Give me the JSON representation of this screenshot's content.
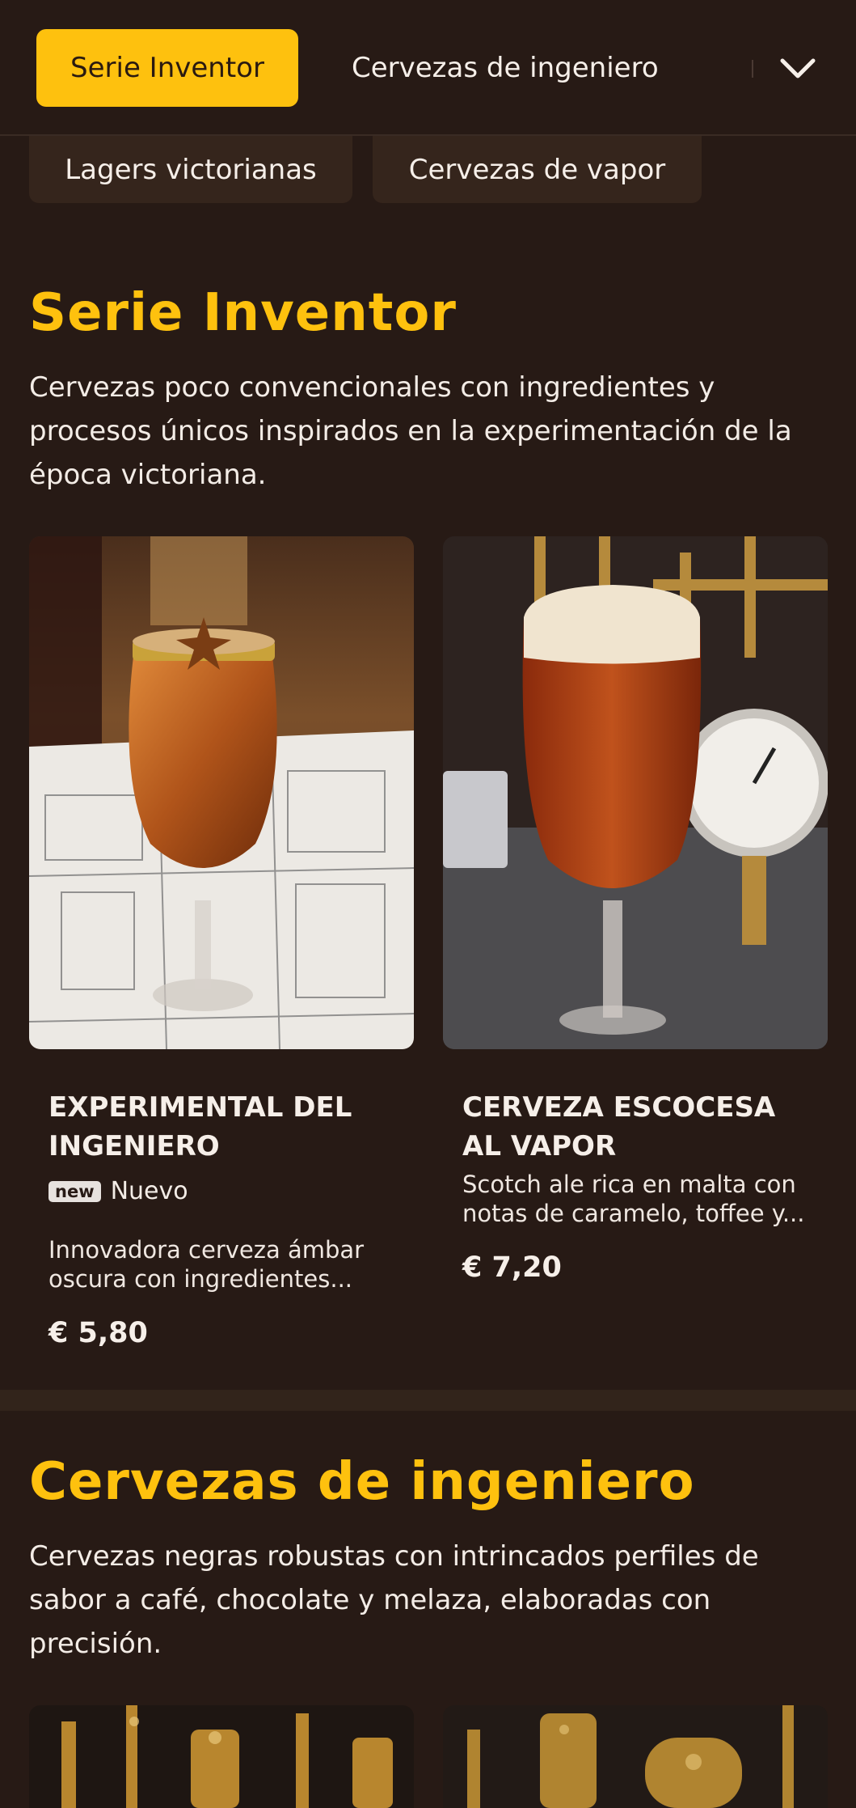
{
  "nav": {
    "active_tab": "Serie Inventor",
    "next_tab": "Cervezas de ingeniero",
    "chevron_icon": "chevron-down-icon"
  },
  "chips": [
    "Lagers victorianas",
    "Cervezas de vapor"
  ],
  "sections": [
    {
      "title": "Serie Inventor",
      "description": "Cervezas poco convencionales con ingredientes y procesos únicos inspirados en la experimentación de la época victoriana.",
      "products": [
        {
          "title": "EXPERIMENTAL DEL INGENIERO",
          "badge": "new",
          "badge_label": "Nuevo",
          "description": "Innovadora cerveza ámbar oscura con ingredientes...",
          "price": "€ 5,80"
        },
        {
          "title": "CERVEZA ESCOCESA AL VAPOR",
          "description": "Scotch ale rica en malta con notas de caramelo, toffee y...",
          "price": "€ 7,20"
        }
      ]
    },
    {
      "title": "Cervezas de ingeniero",
      "description": "Cervezas negras robustas con intrincados perfiles de sabor a café, chocolate y melaza, elaboradas con precisión."
    }
  ],
  "colors": {
    "background": "#271a15",
    "accent": "#fec10e",
    "chip": "#35251c"
  }
}
